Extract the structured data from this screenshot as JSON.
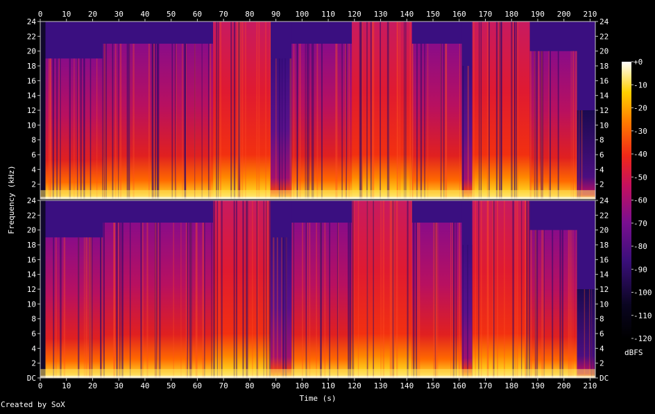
{
  "footer": {
    "credit": "Created by SoX"
  },
  "chart_data": {
    "type": "heatmap",
    "subtype": "spectrogram",
    "channels": 2,
    "xlabel": "Time (s)",
    "ylabel": "Frequency (kHz)",
    "xlim": [
      0,
      212
    ],
    "ylim": [
      0,
      24
    ],
    "x_ticks": [
      "0",
      "10",
      "20",
      "30",
      "40",
      "50",
      "60",
      "70",
      "80",
      "90",
      "100",
      "110",
      "120",
      "130",
      "140",
      "150",
      "160",
      "170",
      "180",
      "190",
      "200",
      "210"
    ],
    "y_ticks_top": [
      "2",
      "4",
      "6",
      "8",
      "10",
      "12",
      "14",
      "16",
      "18",
      "20",
      "22",
      "24"
    ],
    "y_ticks_bottom": [
      "DC",
      "2",
      "4",
      "6",
      "8",
      "10",
      "12",
      "14",
      "16",
      "18",
      "20",
      "22",
      "24"
    ],
    "colorbar": {
      "label": "dBFS",
      "range": [
        -120,
        0
      ],
      "ticks": [
        "+0",
        "-10",
        "-20",
        "-30",
        "-40",
        "-50",
        "-60",
        "-70",
        "-80",
        "-90",
        "-100",
        "-110",
        "-120"
      ]
    },
    "segments": [
      {
        "start": 0,
        "end": 2,
        "level": "silence"
      },
      {
        "start": 2,
        "end": 24,
        "level": "medium",
        "cutoff_khz": 19
      },
      {
        "start": 24,
        "end": 66,
        "level": "medium",
        "cutoff_khz": 21
      },
      {
        "start": 66,
        "end": 88,
        "level": "loud",
        "cutoff_khz": 24
      },
      {
        "start": 88,
        "end": 96,
        "level": "quiet",
        "cutoff_khz": 19
      },
      {
        "start": 96,
        "end": 119,
        "level": "medium",
        "cutoff_khz": 21
      },
      {
        "start": 119,
        "end": 142,
        "level": "loud",
        "cutoff_khz": 24
      },
      {
        "start": 142,
        "end": 161,
        "level": "medium",
        "cutoff_khz": 21
      },
      {
        "start": 161,
        "end": 165,
        "level": "quiet",
        "cutoff_khz": 18
      },
      {
        "start": 165,
        "end": 187,
        "level": "loud",
        "cutoff_khz": 24
      },
      {
        "start": 187,
        "end": 205,
        "level": "medium",
        "cutoff_khz": 20
      },
      {
        "start": 205,
        "end": 212,
        "level": "fade",
        "cutoff_khz": 12
      }
    ]
  }
}
